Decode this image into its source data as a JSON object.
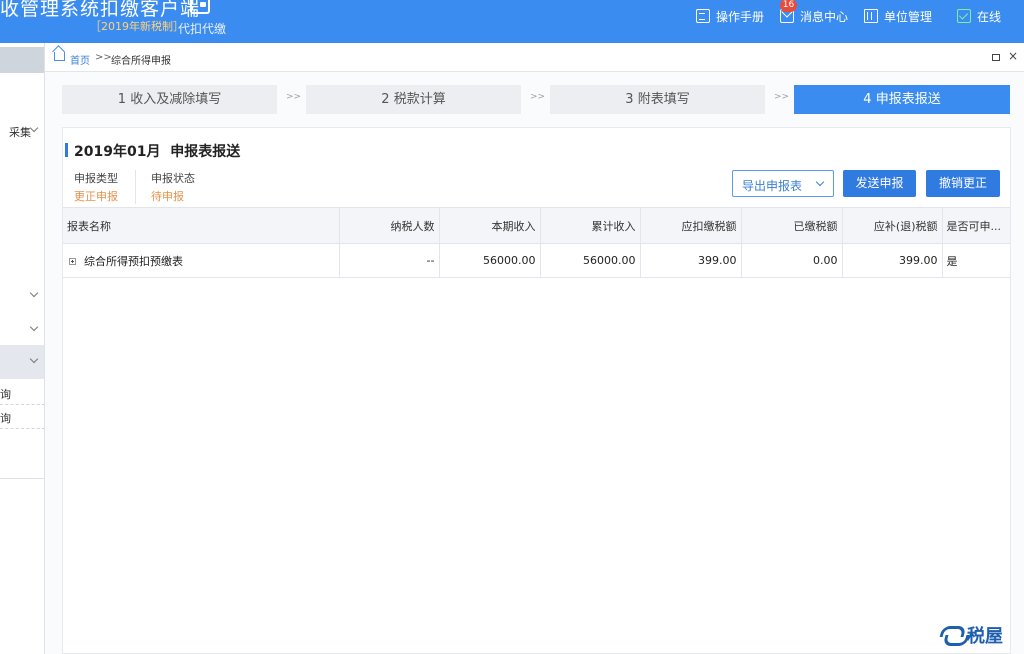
{
  "header": {
    "title": "收管理系统扣缴客户端",
    "subtitle": "［2019年新税制］",
    "mode": "代扣代缴",
    "links": [
      {
        "label": "操作手册",
        "icon": "manual-icon"
      },
      {
        "label": "消息中心",
        "icon": "mail-icon",
        "badge": "16"
      },
      {
        "label": "单位管理",
        "icon": "building-icon"
      },
      {
        "label": "在线",
        "icon": "online-icon"
      }
    ]
  },
  "sidebar": {
    "items": [
      {
        "label": "采集"
      },
      {
        "label": ""
      },
      {
        "label": ""
      },
      {
        "label": ""
      }
    ],
    "sub_items": [
      {
        "label": "询"
      },
      {
        "label": "询"
      }
    ]
  },
  "breadcrumb": {
    "home": "首页",
    "separator": ">>",
    "current": "综合所得申报"
  },
  "steps": [
    {
      "label": "1 收入及减除填写",
      "active": false
    },
    {
      "label": "2 税款计算",
      "active": false
    },
    {
      "label": "3 附表填写",
      "active": false
    },
    {
      "label": "4 申报表报送",
      "active": true
    }
  ],
  "step_separator": ">>",
  "panel": {
    "period": "2019年01月",
    "title": "申报表报送",
    "declare_type_label": "申报类型",
    "declare_type_value": "更正申报",
    "declare_status_label": "申报状态",
    "declare_status_value": "待申报"
  },
  "actions": {
    "export": "导出申报表",
    "send": "发送申报",
    "revoke": "撤销更正"
  },
  "table": {
    "columns": [
      "报表名称",
      "纳税人数",
      "本期收入",
      "累计收入",
      "应扣缴税额",
      "已缴税额",
      "应补(退)税额",
      "是否可申..."
    ],
    "rows": [
      [
        "综合所得预扣预缴表",
        "--",
        "56000.00",
        "56000.00",
        "399.00",
        "0.00",
        "399.00",
        "是"
      ]
    ]
  },
  "watermark": "税屋",
  "colors": {
    "header_bg": "#3b8cf0",
    "active_step": "#3b8cf0",
    "primary_button": "#2f7be0",
    "status_orange": "#e8914a",
    "yes_green": "#27a04a"
  }
}
